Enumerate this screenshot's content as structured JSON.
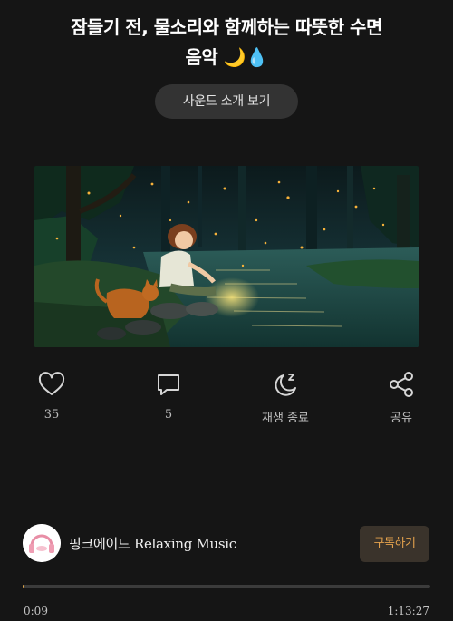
{
  "video": {
    "title_line1": "잠들기 전, 물소리와 함께하는 따뜻한 수면",
    "title_line2": "음악 🌙💧"
  },
  "intro_button": {
    "label": "사운드 소개 보기"
  },
  "actions": {
    "like": {
      "icon": "heart-icon",
      "label": "35"
    },
    "comment": {
      "icon": "comment-icon",
      "label": "5"
    },
    "sleep_timer": {
      "icon": "sleep-moon-icon",
      "label": "재생 종료"
    },
    "share": {
      "icon": "share-icon",
      "label": "공유"
    }
  },
  "channel": {
    "name": "핑크에이드 Relaxing Music",
    "avatar_icon": "headphones-avatar-icon",
    "subscribe_label": "구독하기"
  },
  "player": {
    "current_time": "0:09",
    "total_time": "1:13:27",
    "progress_fraction": 0.002
  },
  "colors": {
    "background": "#151515",
    "accent": "#d9a24a",
    "subscribe_text": "#e4a24d",
    "button_bg": "#333333"
  }
}
